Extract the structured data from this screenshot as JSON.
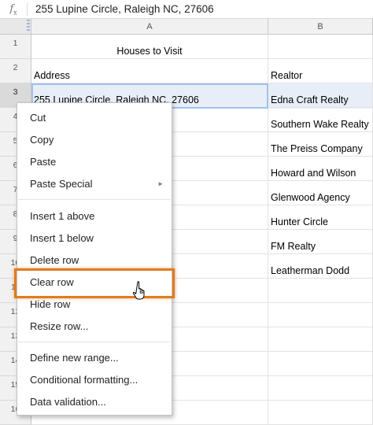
{
  "formula_bar": {
    "fx_label": "f",
    "fx_sub": "x",
    "value": "255 Lupine Circle, Raleigh NC, 27606"
  },
  "columns": [
    "A",
    "B"
  ],
  "rows": [
    {
      "num": "1",
      "a": "Houses to Visit",
      "b": ""
    },
    {
      "num": "2",
      "a": "Address",
      "b": "Realtor"
    },
    {
      "num": "3",
      "a": "255 Lupine Circle, Raleigh NC, 27606",
      "b": "Edna Craft Realty"
    },
    {
      "num": "4",
      "a": "er NC, 27560",
      "b": "Southern Wake Realty"
    },
    {
      "num": "5",
      "a": "n NC, 27705",
      "b": "The Preiss Company"
    },
    {
      "num": "6",
      "a": "est NC, 27605",
      "b": "Howard and Wilson"
    },
    {
      "num": "7",
      "a": "603",
      "b": "Glenwood Agency"
    },
    {
      "num": "8",
      "a": "sville NC, 27735",
      "b": "Hunter Circle"
    },
    {
      "num": "9",
      "a": "NC, 27610",
      "b": "FM Realty"
    },
    {
      "num": "10",
      "a": "el Hill NC, 25403",
      "b": "Leatherman Dodd"
    },
    {
      "num": "11",
      "a": "",
      "b": ""
    },
    {
      "num": "12",
      "a": "",
      "b": ""
    },
    {
      "num": "13",
      "a": "",
      "b": ""
    },
    {
      "num": "14",
      "a": "",
      "b": ""
    },
    {
      "num": "15",
      "a": "",
      "b": ""
    },
    {
      "num": "16",
      "a": "",
      "b": ""
    }
  ],
  "selected_row": "3",
  "context_menu": {
    "cut": "Cut",
    "copy": "Copy",
    "paste": "Paste",
    "paste_special": "Paste Special",
    "insert_above": "Insert 1 above",
    "insert_below": "Insert 1 below",
    "delete_row": "Delete row",
    "clear_row": "Clear row",
    "hide_row": "Hide row",
    "resize_row": "Resize row...",
    "define_range": "Define new range...",
    "conditional_formatting": "Conditional formatting...",
    "data_validation": "Data validation..."
  },
  "colors": {
    "highlight": "#e07b1f",
    "selection": "#a3c0ee"
  }
}
